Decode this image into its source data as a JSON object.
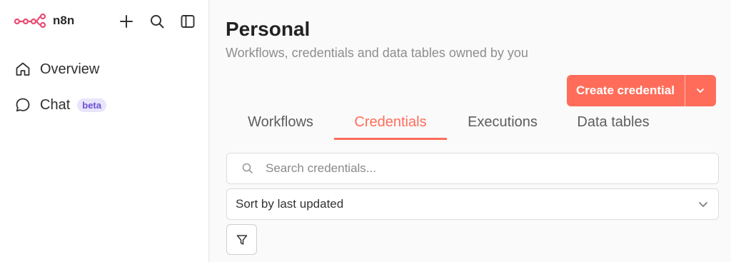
{
  "brand": {
    "name": "n8n",
    "logo_icon": "n8n-logo-icon",
    "logo_color": "#ea4b71"
  },
  "top_actions": [
    {
      "icon": "plus-icon"
    },
    {
      "icon": "search-icon"
    },
    {
      "icon": "sidebar-toggle-icon"
    }
  ],
  "nav": {
    "items": [
      {
        "label": "Overview",
        "icon": "home-icon"
      },
      {
        "label": "Chat",
        "icon": "chat-icon",
        "badge": "beta"
      }
    ]
  },
  "page": {
    "title": "Personal",
    "subtitle": "Workflows, credentials and data tables owned by you"
  },
  "actions": {
    "create_label": "Create credential",
    "caret_icon": "chevron-down-icon",
    "accent": "#ff6d5a"
  },
  "tabs": [
    {
      "label": "Workflows",
      "active": false
    },
    {
      "label": "Credentials",
      "active": true
    },
    {
      "label": "Executions",
      "active": false
    },
    {
      "label": "Data tables",
      "active": false
    }
  ],
  "search": {
    "placeholder": "Search credentials...",
    "value": ""
  },
  "sort": {
    "selected": "Sort by last updated"
  },
  "filter": {
    "icon": "filter-icon"
  }
}
